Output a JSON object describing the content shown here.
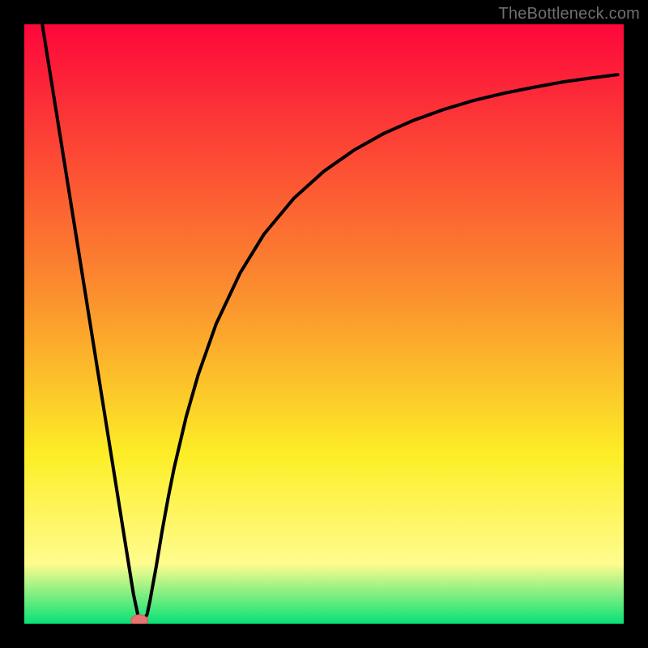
{
  "attribution": "TheBottleneck.com",
  "colors": {
    "frame": "#000000",
    "grad_top": "#fd073b",
    "grad_mid1": "#fb8f2e",
    "grad_mid2": "#fdee27",
    "grad_mid3": "#fffc8e",
    "grad_bottom": "#08e176",
    "curve": "#000000",
    "marker_fill": "#e77372",
    "marker_stroke": "#d65a59"
  },
  "chart_data": {
    "type": "line",
    "title": "",
    "xlabel": "",
    "ylabel": "",
    "xlim": [
      0,
      100
    ],
    "ylim": [
      0,
      100
    ],
    "x": [
      3.0,
      5.0,
      7.0,
      9.0,
      11.0,
      13.0,
      15.0,
      17.0,
      18.2,
      19.0,
      19.5,
      20.0,
      20.5,
      21.0,
      22.0,
      23.0,
      24.0,
      25.0,
      27.0,
      29.0,
      32.0,
      36.0,
      40.0,
      45.0,
      50.0,
      55.0,
      60.0,
      65.0,
      70.0,
      75.0,
      80.0,
      85.0,
      90.0,
      95.0,
      99.0
    ],
    "y": [
      100.0,
      87.5,
      75.0,
      62.5,
      50.0,
      37.5,
      25.0,
      12.5,
      5.0,
      1.2,
      0.3,
      0.7,
      1.6,
      4.0,
      9.5,
      15.5,
      21.0,
      26.0,
      34.5,
      41.5,
      50.0,
      58.5,
      65.0,
      71.0,
      75.5,
      79.0,
      81.8,
      84.0,
      85.8,
      87.3,
      88.5,
      89.5,
      90.4,
      91.1,
      91.6
    ],
    "marker": {
      "x": 19.2,
      "y": 0.5,
      "rx": 1.4,
      "ry": 1.0
    }
  }
}
